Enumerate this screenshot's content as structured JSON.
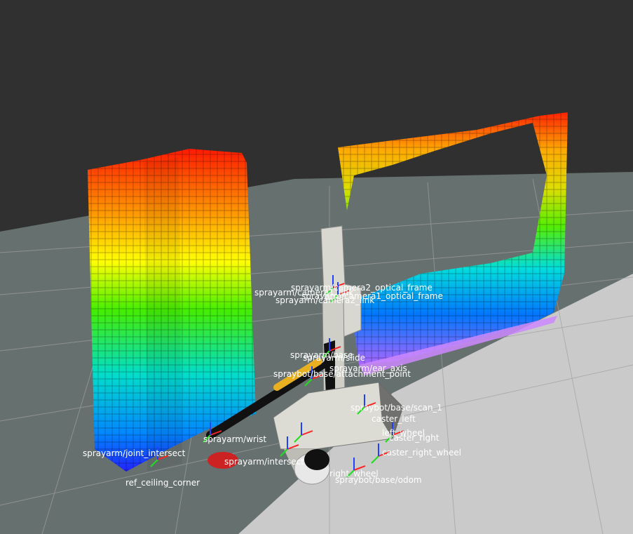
{
  "scene": {
    "background_color": "#303030",
    "grid_color": "#a0a0a0",
    "floor_colors": [
      "#66706f",
      "#c9c9c9"
    ],
    "voxel_color_scale": [
      "#ff0000",
      "#ffff00",
      "#00ff00",
      "#00ffff",
      "#0000ff",
      "#ff80ff"
    ]
  },
  "tf_frames": [
    "sprayarm/camera1_link",
    "sprayarm/camera1_optical_frame",
    "sprayarm/camera2_link",
    "sprayarm/camera2_optical_frame",
    "spraybot/base/attachment_point",
    "spraybot/base/scan_1",
    "spraybot/base/odom",
    "sprayarm/base",
    "sprayarm/slide",
    "sprayarm/ear_axis",
    "sprayarm/wrist",
    "sprayarm/intersect",
    "caster_right",
    "caster_right_wheel",
    "caster_left",
    "left_wheel",
    "right_wheel",
    "ref_ceiling_corner",
    "sprayarm/joint_intersect"
  ]
}
